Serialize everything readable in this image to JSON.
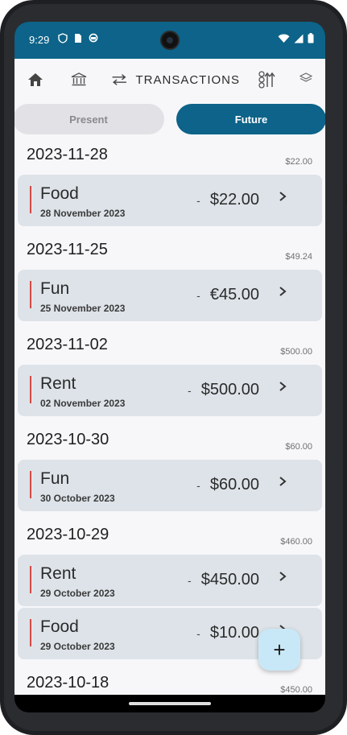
{
  "status_bar": {
    "time": "9:29",
    "left_icons": [
      "shield-icon",
      "sim-icon",
      "sync-icon"
    ],
    "right_icons": [
      "wifi-icon",
      "signal-icon",
      "battery-icon"
    ]
  },
  "topnav": {
    "home_icon": "home-icon",
    "bank_icon": "bank-icon",
    "transactions_icon": "swap-arrows-icon",
    "title": "TRANSACTIONS",
    "sort_icon": "sort-icon",
    "layers_icon": "layers-icon"
  },
  "tabs": {
    "present": "Present",
    "future": "Future",
    "active": "Future"
  },
  "groups": [
    {
      "date": "2023-11-28",
      "total": "$22.00",
      "items": [
        {
          "category": "Food",
          "date": "28 November 2023",
          "sign": "-",
          "amount": "$22.00"
        }
      ]
    },
    {
      "date": "2023-11-25",
      "total": "$49.24",
      "items": [
        {
          "category": "Fun",
          "date": "25 November 2023",
          "sign": "-",
          "amount": "€45.00"
        }
      ]
    },
    {
      "date": "2023-11-02",
      "total": "$500.00",
      "items": [
        {
          "category": "Rent",
          "date": "02 November 2023",
          "sign": "-",
          "amount": "$500.00"
        }
      ]
    },
    {
      "date": "2023-10-30",
      "total": "$60.00",
      "items": [
        {
          "category": "Fun",
          "date": "30 October 2023",
          "sign": "-",
          "amount": "$60.00"
        }
      ]
    },
    {
      "date": "2023-10-29",
      "total": "$460.00",
      "items": [
        {
          "category": "Rent",
          "date": "29 October 2023",
          "sign": "-",
          "amount": "$450.00"
        },
        {
          "category": "Food",
          "date": "29 October 2023",
          "sign": "-",
          "amount": "$10.00"
        }
      ]
    },
    {
      "date": "2023-10-18",
      "total": "$450.00",
      "items": []
    }
  ],
  "fab": {
    "label": "+",
    "icon": "plus-icon"
  },
  "colors": {
    "primary": "#0d6389",
    "card_bg": "#dde3e8",
    "accent_bar": "#d34b45",
    "fab_bg": "#c9e8f7"
  }
}
